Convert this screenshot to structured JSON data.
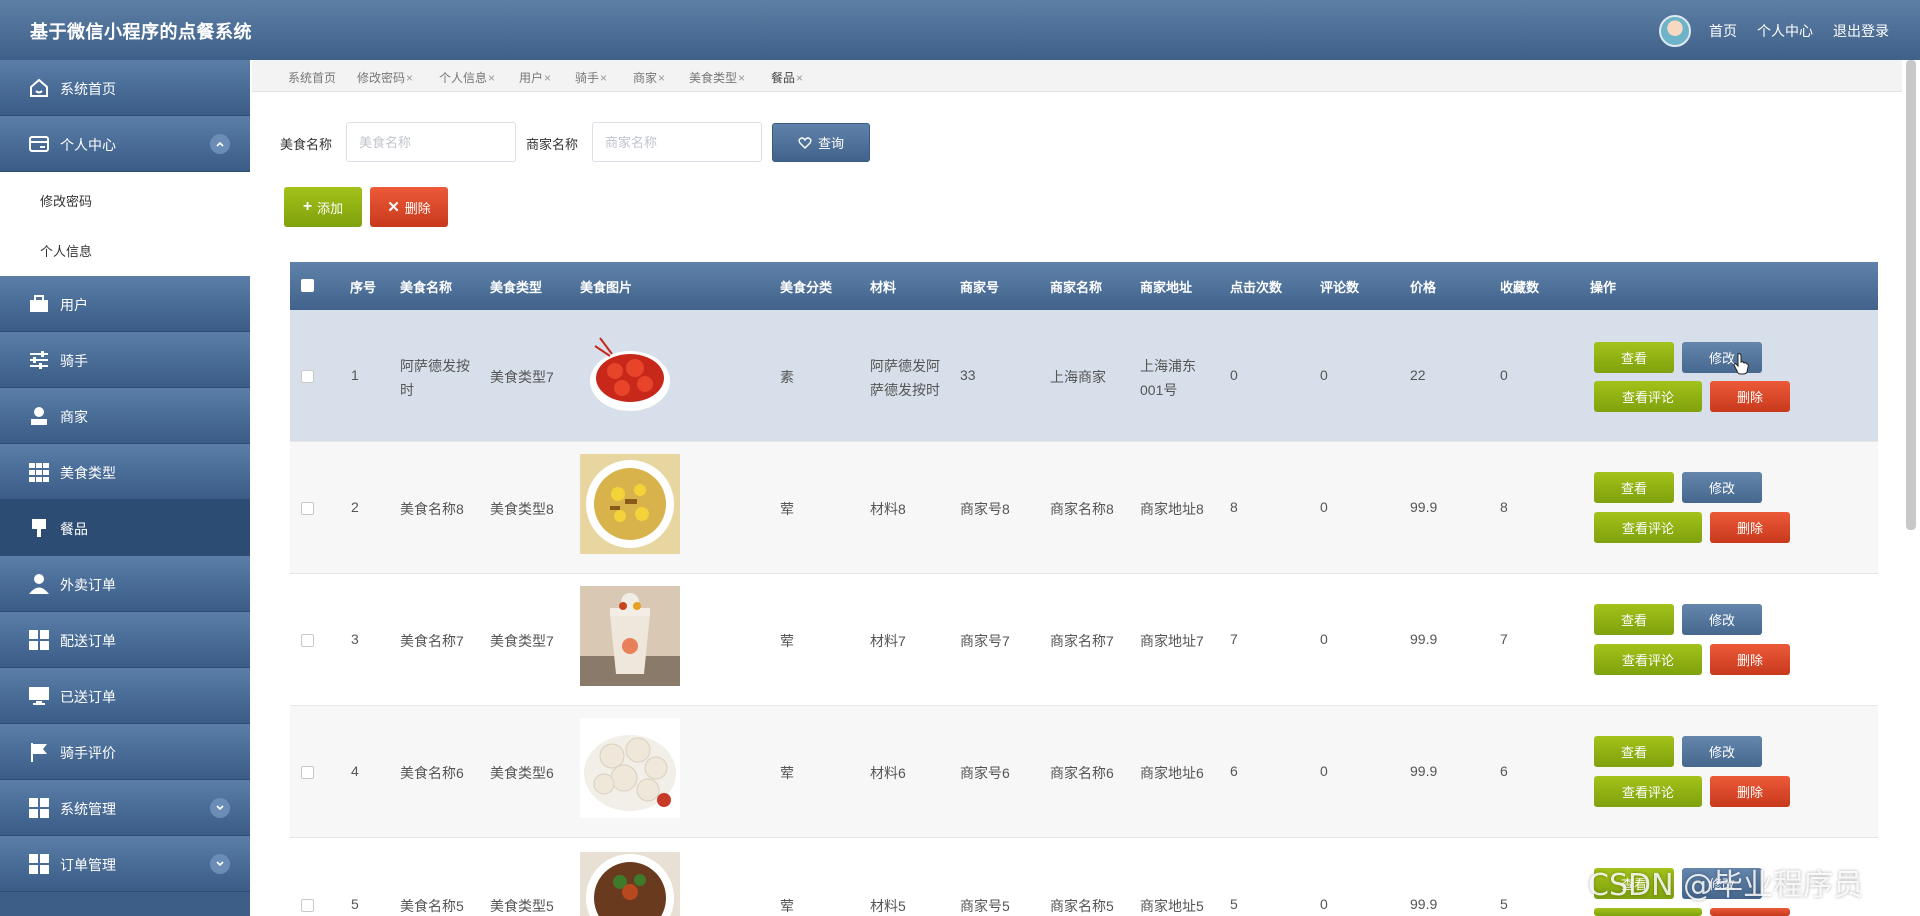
{
  "header": {
    "title": "基于微信小程序的点餐系统",
    "nav_home": "首页",
    "nav_center": "个人中心",
    "nav_logout": "退出登录"
  },
  "sidebar": {
    "items": [
      {
        "label": "系统首页",
        "icon": "home-icon"
      },
      {
        "label": "个人中心",
        "icon": "card-icon"
      },
      {
        "label": "用户",
        "icon": "briefcase-icon"
      },
      {
        "label": "骑手",
        "icon": "sliders-icon"
      },
      {
        "label": "商家",
        "icon": "user-icon"
      },
      {
        "label": "美食类型",
        "icon": "grid-icon"
      },
      {
        "label": "餐品",
        "icon": "pin-icon"
      },
      {
        "label": "外卖订单",
        "icon": "person-icon"
      },
      {
        "label": "配送订单",
        "icon": "tiles-icon"
      },
      {
        "label": "已送订单",
        "icon": "monitor-icon"
      },
      {
        "label": "骑手评价",
        "icon": "flag-icon"
      },
      {
        "label": "系统管理",
        "icon": "tiles-icon"
      },
      {
        "label": "订单管理",
        "icon": "tiles-icon"
      }
    ],
    "sub": [
      "修改密码",
      "个人信息"
    ]
  },
  "tabs": [
    "系统首页",
    "修改密码",
    "个人信息",
    "用户",
    "骑手",
    "商家",
    "美食类型",
    "餐品"
  ],
  "search": {
    "food_label": "美食名称",
    "food_placeholder": "美食名称",
    "shop_label": "商家名称",
    "shop_placeholder": "商家名称",
    "query": "查询"
  },
  "actions": {
    "add": "添加",
    "delete": "删除"
  },
  "table": {
    "headers": [
      "序号",
      "美食名称",
      "美食类型",
      "美食图片",
      "美食分类",
      "材料",
      "商家号",
      "商家名称",
      "商家地址",
      "点击次数",
      "评论数",
      "价格",
      "收藏数",
      "操作"
    ],
    "rows": [
      {
        "no": "1",
        "name": "阿萨德发按时",
        "type": "美食类型7",
        "category": "素",
        "material": "阿萨德发阿萨德发按时",
        "shop_no": "33",
        "shop_name": "上海商家",
        "address": "上海浦东001号",
        "clicks": "0",
        "comments": "0",
        "price": "22",
        "favorites": "0"
      },
      {
        "no": "2",
        "name": "美食名称8",
        "type": "美食类型8",
        "category": "荤",
        "material": "材料8",
        "shop_no": "商家号8",
        "shop_name": "商家名称8",
        "address": "商家地址8",
        "clicks": "8",
        "comments": "0",
        "price": "99.9",
        "favorites": "8"
      },
      {
        "no": "3",
        "name": "美食名称7",
        "type": "美食类型7",
        "category": "荤",
        "material": "材料7",
        "shop_no": "商家号7",
        "shop_name": "商家名称7",
        "address": "商家地址7",
        "clicks": "7",
        "comments": "0",
        "price": "99.9",
        "favorites": "7"
      },
      {
        "no": "4",
        "name": "美食名称6",
        "type": "美食类型6",
        "category": "荤",
        "material": "材料6",
        "shop_no": "商家号6",
        "shop_name": "商家名称6",
        "address": "商家地址6",
        "clicks": "6",
        "comments": "0",
        "price": "99.9",
        "favorites": "6"
      },
      {
        "no": "5",
        "name": "美食名称5",
        "type": "美食类型5",
        "category": "荤",
        "material": "材料5",
        "shop_no": "商家号5",
        "shop_name": "商家名称5",
        "address": "商家地址5",
        "clicks": "5",
        "comments": "0",
        "price": "99.9",
        "favorites": "5"
      }
    ],
    "row_buttons": {
      "view": "查看",
      "edit": "修改",
      "comments": "查看评论",
      "remove": "删除"
    }
  },
  "watermark": "CSDN @毕业程序员"
}
